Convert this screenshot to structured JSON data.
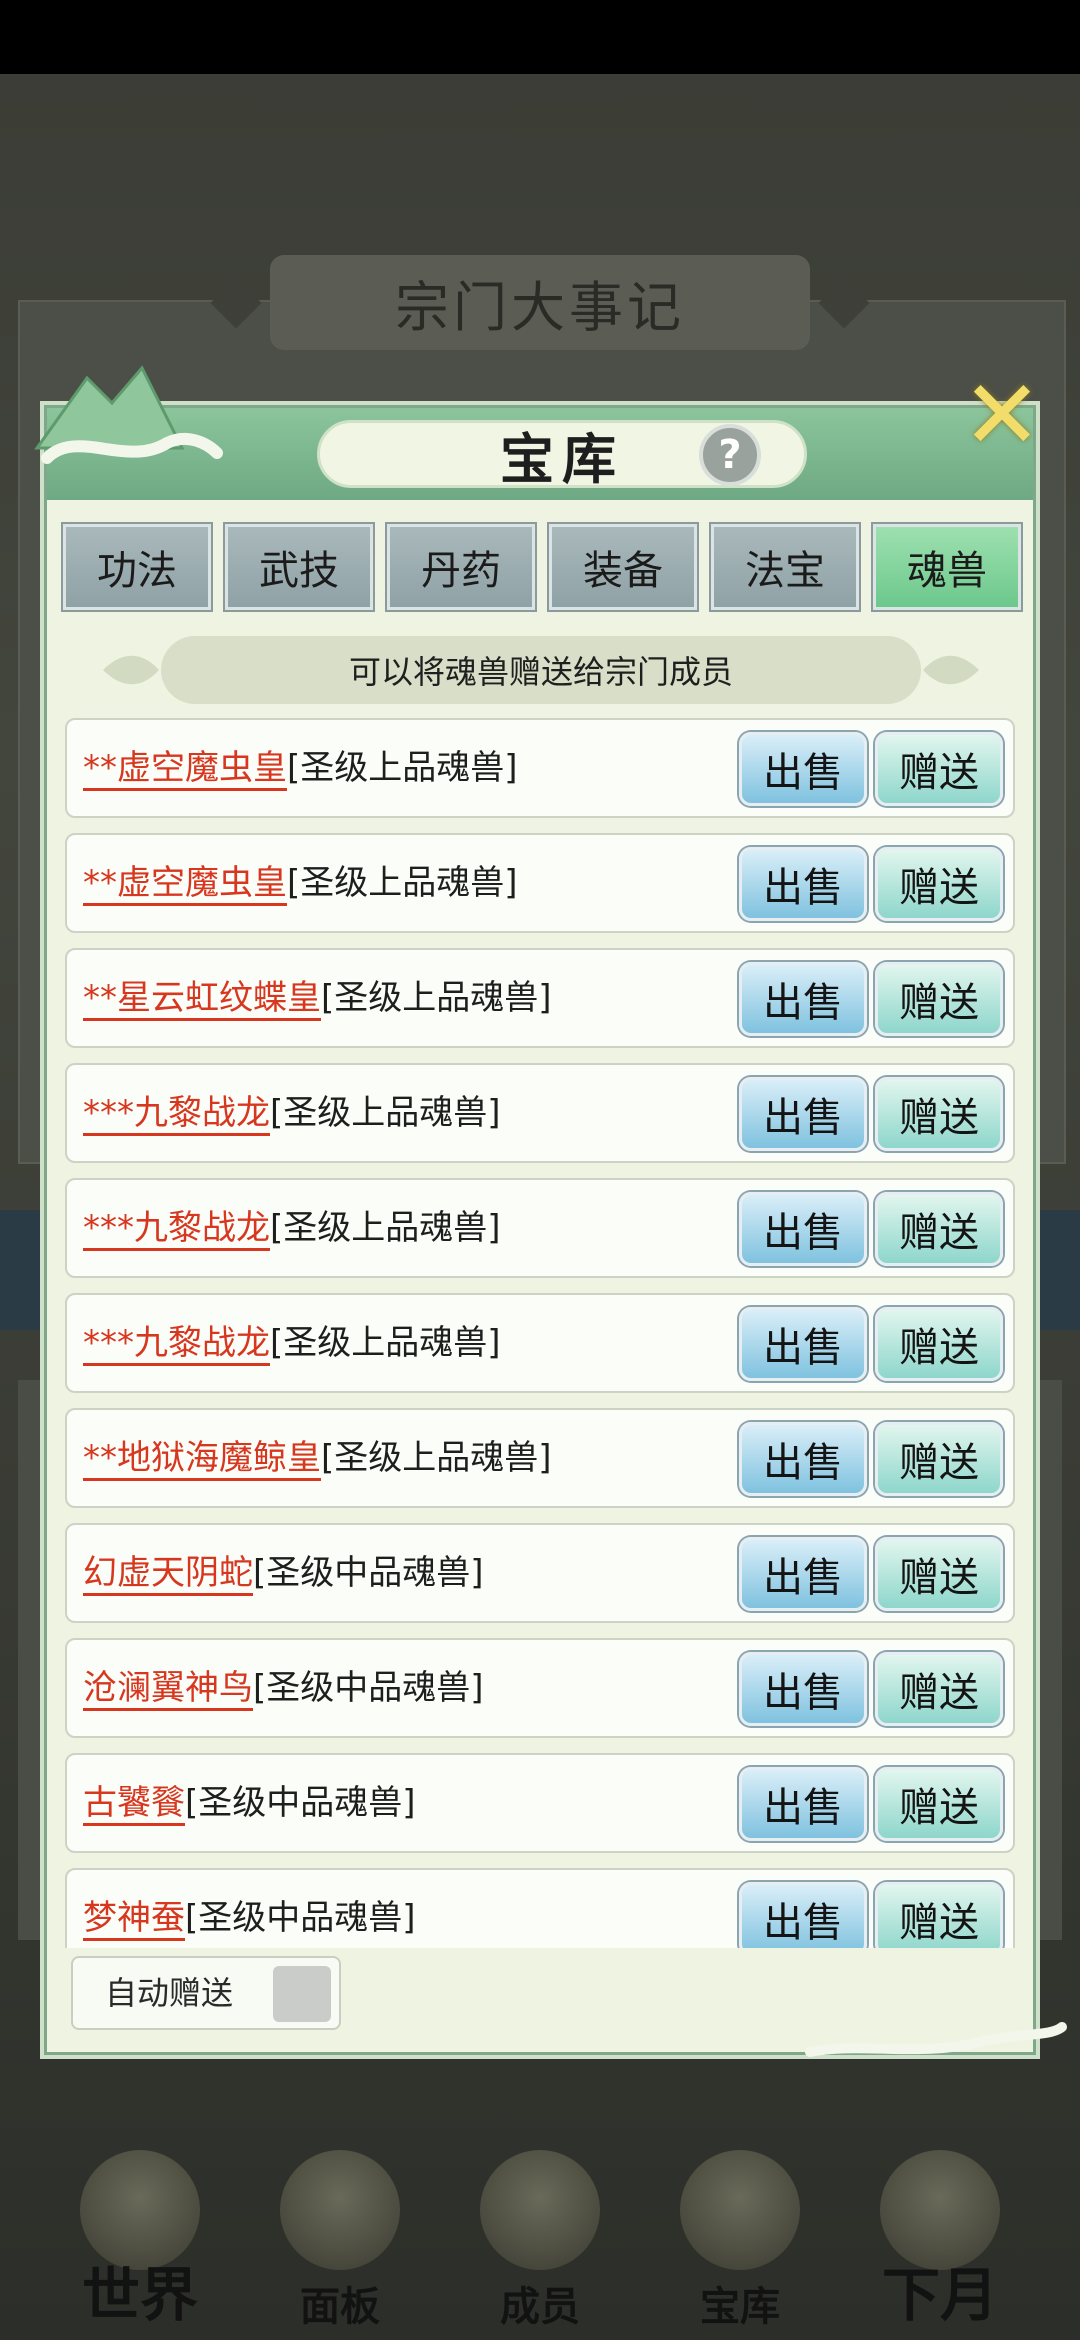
{
  "background": {
    "chronicle_title": "宗门大事记"
  },
  "bottom_nav": {
    "items": [
      {
        "label": "世界",
        "icon": "world-pagoda-icon"
      },
      {
        "label": "面板",
        "icon": "panel-gate-icon"
      },
      {
        "label": "成员",
        "icon": "member-figure-icon"
      },
      {
        "label": "宝库",
        "icon": "treasury-tower-icon"
      },
      {
        "label": "下月",
        "icon": "crescent-moon-icon"
      }
    ]
  },
  "modal": {
    "title": "宝库",
    "help_symbol": "?",
    "close_symbol": "✕",
    "tabs": [
      {
        "label": "功法"
      },
      {
        "label": "武技"
      },
      {
        "label": "丹药"
      },
      {
        "label": "装备"
      },
      {
        "label": "法宝"
      },
      {
        "label": "魂兽"
      }
    ],
    "active_tab": "魂兽",
    "hint": "可以将魂兽赠送给宗门成员",
    "sell_label": "出售",
    "gift_label": "赠送",
    "items": [
      {
        "name": "**虚空魔虫皇",
        "grade": "[圣级上品魂兽]"
      },
      {
        "name": "**虚空魔虫皇",
        "grade": "[圣级上品魂兽]"
      },
      {
        "name": "**星云虹纹蝶皇",
        "grade": "[圣级上品魂兽]"
      },
      {
        "name": "***九黎战龙",
        "grade": "[圣级上品魂兽]"
      },
      {
        "name": "***九黎战龙",
        "grade": "[圣级上品魂兽]"
      },
      {
        "name": "***九黎战龙",
        "grade": "[圣级上品魂兽]"
      },
      {
        "name": "**地狱海魔鲸皇",
        "grade": "[圣级上品魂兽]"
      },
      {
        "name": "幻虚天阴蛇",
        "grade": "[圣级中品魂兽]"
      },
      {
        "name": "沧澜翼神鸟",
        "grade": "[圣级中品魂兽]"
      },
      {
        "name": "古饕餮",
        "grade": "[圣级中品魂兽]"
      },
      {
        "name": "梦神蚕",
        "grade": "[圣级中品魂兽]"
      }
    ],
    "auto_gift_label": "自动赠送",
    "auto_gift_checked": false
  },
  "colors": {
    "item_name": "#d8371f",
    "active_tab": "#6cc88c",
    "tab": "#8fa2a6",
    "header": "#7ab58f"
  }
}
